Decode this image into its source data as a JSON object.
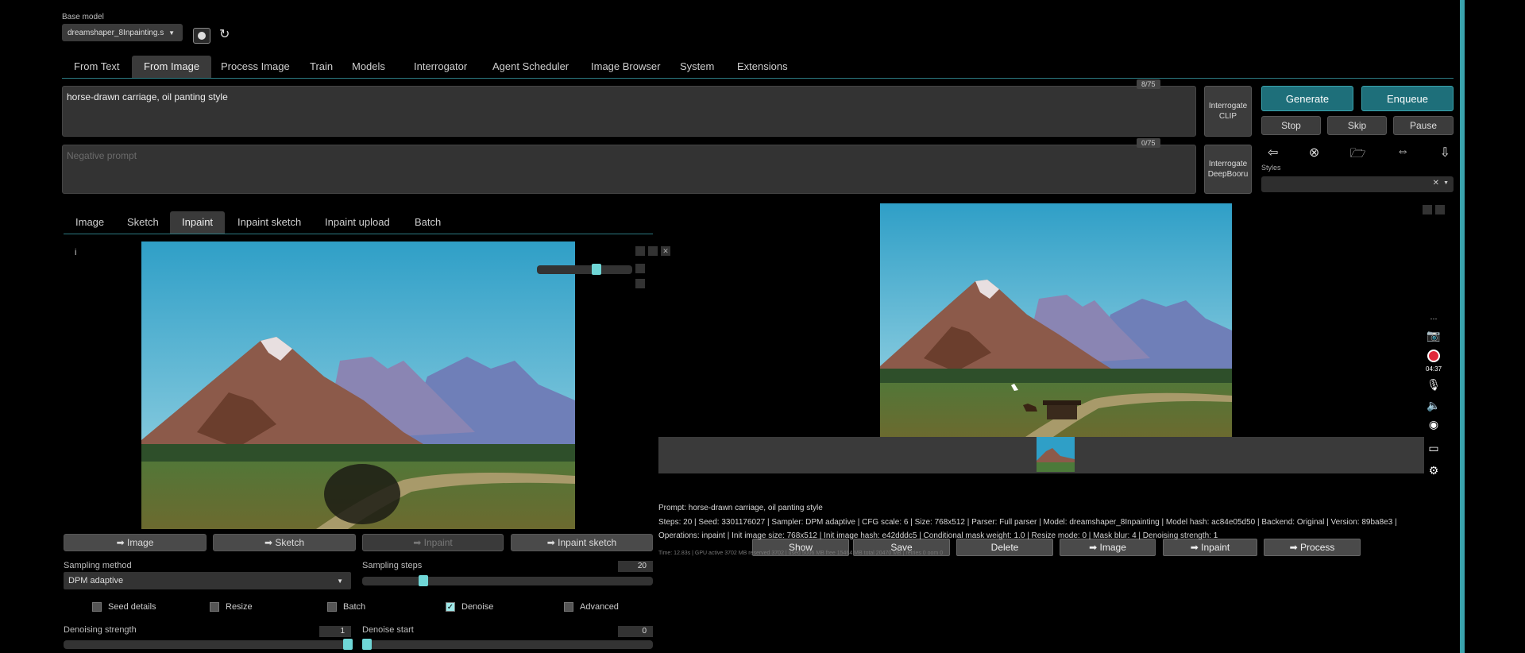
{
  "header": {
    "base_model_label": "Base model",
    "model_value": "dreamshaper_8Inpainting.s",
    "refresh_icon": "refresh-icon",
    "reload_icon": "reload-icon"
  },
  "main_tabs": [
    "From Text",
    "From Image",
    "Process Image",
    "Train",
    "Models",
    "Interrogator",
    "Agent Scheduler",
    "Image Browser",
    "System",
    "Extensions"
  ],
  "active_main_tab": "From Image",
  "prompt": {
    "value": "horse-drawn carriage, oil panting style",
    "counter": "8/75"
  },
  "negative_prompt": {
    "placeholder": "Negative prompt",
    "counter": "0/75"
  },
  "interrogate": {
    "clip_line1": "Interrogate",
    "clip_line2": "CLIP",
    "deepbooru_line1": "Interrogate",
    "deepbooru_line2": "DeepBooru"
  },
  "controls": {
    "generate": "Generate",
    "enqueue": "Enqueue",
    "stop": "Stop",
    "skip": "Skip",
    "pause": "Pause",
    "styles_label": "Styles",
    "tool_icons": [
      "arrow-left-icon",
      "circle-x-icon",
      "folder-open-icon",
      "swap-arrows-icon",
      "download-icon"
    ],
    "tool_glyphs": [
      "⇦",
      "⊗",
      "🗁",
      "⇔",
      "⇩"
    ]
  },
  "image_tabs": [
    "Image",
    "Sketch",
    "Inpaint",
    "Inpaint sketch",
    "Inpaint upload",
    "Batch"
  ],
  "active_image_tab": "Inpaint",
  "canvas": {
    "info_marker": "i"
  },
  "send_buttons": [
    "➡ Image",
    "➡ Sketch",
    "➡ Inpaint",
    "➡ Inpaint sketch"
  ],
  "sampling": {
    "method_label": "Sampling method",
    "method_value": "DPM adaptive",
    "steps_label": "Sampling steps",
    "steps_value": "20",
    "steps_fraction": 0.2
  },
  "checkboxes": [
    {
      "label": "Seed details",
      "checked": false
    },
    {
      "label": "Resize",
      "checked": false
    },
    {
      "label": "Batch",
      "checked": false
    },
    {
      "label": "Denoise",
      "checked": true
    },
    {
      "label": "Advanced",
      "checked": false
    }
  ],
  "denoise": {
    "strength_label": "Denoising strength",
    "strength_value": "1",
    "start_label": "Denoise start",
    "start_value": "0"
  },
  "output": {
    "actions": [
      "Show",
      "Save",
      "Delete",
      "➡ Image",
      "➡ Inpaint",
      "➡ Process"
    ],
    "info_prompt": "Prompt: horse-drawn carriage, oil panting style",
    "info_params": "Steps: 20 | Seed: 3301176027 | Sampler: DPM adaptive | CFG scale: 6 | Size: 768x512 | Parser: Full parser | Model: dreamshaper_8Inpainting | Model hash: ac84e05d50 | Backend: Original | Version: 89ba8e3 |",
    "info_ops": "Operations: inpaint | Init image size: 768x512 | Init image hash: e42dddc5 | Conditional mask weight: 1.0 | Resize mode: 0 | Mask blur: 4 | Denoising strength: 1",
    "info_time": "Time: 12.83s | GPU active 3702 MB reserved 3702 | used 5006 MB free 15464 MB total 20470 MB | retries 0 oom 0"
  },
  "recorder": {
    "timer": "04:37",
    "icons": [
      "camera-icon",
      "record-icon",
      "microphone-icon",
      "speaker-icon",
      "webcam-icon",
      "window-icon",
      "settings-icon"
    ]
  },
  "colors": {
    "accent": "#1e6f7a",
    "slider_thumb": "#6fd6d6",
    "scrollbar": "#3aa3ad"
  }
}
